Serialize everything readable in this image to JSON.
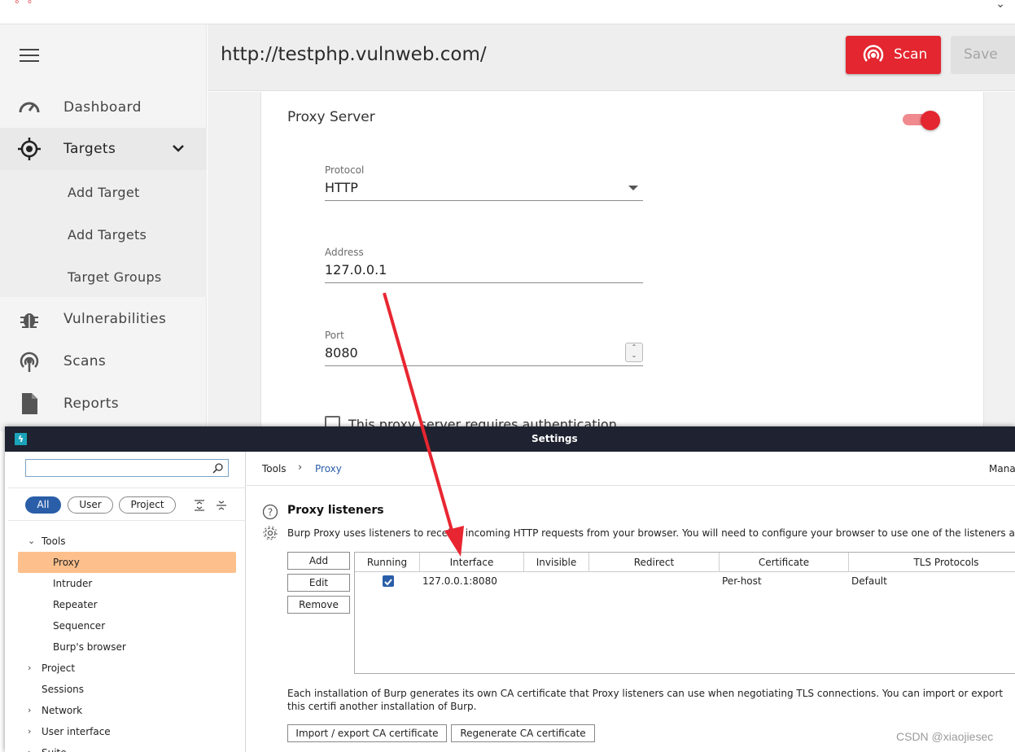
{
  "acunetix": {
    "nav": {
      "dashboard": "Dashboard",
      "targets": "Targets",
      "sub": [
        "Add Target",
        "Add Targets",
        "Target Groups"
      ],
      "vulnerabilities": "Vulnerabilities",
      "scans": "Scans",
      "reports": "Reports"
    },
    "header": {
      "url": "http://testphp.vulnweb.com/",
      "scan_label": "Scan",
      "save_label": "Save"
    },
    "proxy": {
      "title": "Proxy Server",
      "enabled": true,
      "protocol_label": "Protocol",
      "protocol_value": "HTTP",
      "address_label": "Address",
      "address_value": "127.0.0.1",
      "port_label": "Port",
      "port_value": "8080",
      "auth_label": "This proxy server requires authentication"
    },
    "colors": {
      "accent": "#e3262f"
    }
  },
  "burp": {
    "window_title": "Settings",
    "filters": [
      "All",
      "User",
      "Project"
    ],
    "tree": {
      "tools": "Tools",
      "tool_items": [
        "Proxy",
        "Intruder",
        "Repeater",
        "Sequencer",
        "Burp's browser"
      ],
      "project": "Project",
      "sessions": "Sessions",
      "network": "Network",
      "user_interface": "User interface",
      "suite": "Suite"
    },
    "breadcrumb": {
      "root": "Tools",
      "current": "Proxy",
      "right": "Mana"
    },
    "section": {
      "title": "Proxy listeners",
      "desc": "Burp Proxy uses listeners to receive incoming HTTP requests from your browser. You will need to configure your browser to use one of the listeners as its prox"
    },
    "buttons": {
      "add": "Add",
      "edit": "Edit",
      "remove": "Remove",
      "import_export": "Import / export CA certificate",
      "regenerate": "Regenerate CA certificate"
    },
    "table": {
      "headers": [
        "Running",
        "Interface",
        "Invisible",
        "Redirect",
        "Certificate",
        "TLS Protocols"
      ],
      "row": {
        "running": true,
        "interface": "127.0.0.1:8080",
        "invisible": "",
        "redirect": "",
        "certificate": "Per-host",
        "tls": "Default"
      }
    },
    "ca_note": "Each installation of Burp generates its own CA certificate that Proxy listeners can use when negotiating TLS connections. You can import or export this certifi another installation of Burp."
  },
  "watermark": "CSDN @xiaojiesec"
}
